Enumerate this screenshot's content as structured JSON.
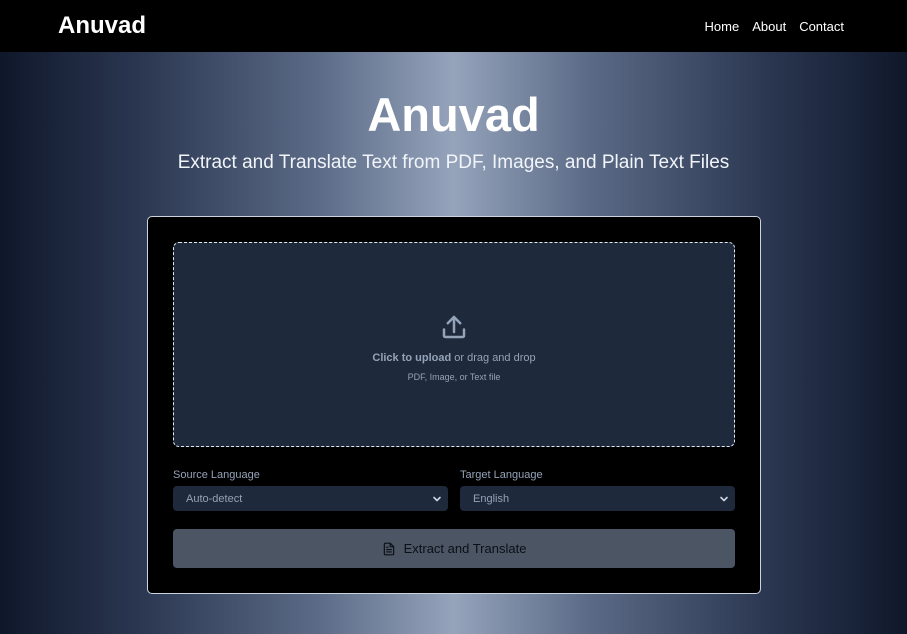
{
  "colors": {
    "navbar": "#000000",
    "card": "#000000",
    "dropzone": "#1e293b",
    "button": "#4b5563",
    "text_muted": "#94a3b8"
  },
  "navbar": {
    "brand": "Anuvad",
    "links": [
      "Home",
      "About",
      "Contact"
    ]
  },
  "hero": {
    "title": "Anuvad",
    "subtitle": "Extract and Translate Text from PDF, Images, and Plain Text Files"
  },
  "upload": {
    "icon": "upload-icon",
    "click_text": "Click to upload",
    "drag_text": "or drag and drop",
    "hint": "PDF, Image, or Text file"
  },
  "source_language": {
    "label": "Source Language",
    "selected": "Auto-detect"
  },
  "target_language": {
    "label": "Target Language",
    "selected": "English"
  },
  "submit": {
    "icon": "document-icon",
    "label": "Extract and Translate"
  }
}
